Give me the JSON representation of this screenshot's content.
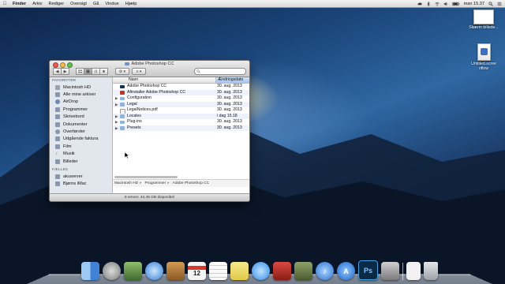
{
  "menubar": {
    "apple_glyph": "",
    "app_name": "Finder",
    "menus": [
      "Arkiv",
      "Rediger",
      "Oversigt",
      "Gå",
      "Vindue",
      "Hjælp"
    ],
    "clock": "man 15.37",
    "status_icons": [
      "cloud-icon",
      "bluetooth-icon",
      "wifi-icon",
      "volume-icon",
      "battery-icon",
      "search-icon",
      "list-icon"
    ]
  },
  "desktop_items": [
    {
      "label": "Skærm billede...",
      "icon": "screenshot-icon"
    },
    {
      "label": "Untitled.scree nflow",
      "icon": "screenflow-document-icon"
    }
  ],
  "window": {
    "title": "Adobe Photoshop CC",
    "search_placeholder": "",
    "toolbar": {
      "back": "◀",
      "forward": "▶",
      "action": "⚙ ▾",
      "arrange": "≡ ▾"
    },
    "sidebar": {
      "favorites_header": "FAVORITTER",
      "favorites": [
        {
          "label": "Macintosh HD",
          "icon": "hard-drive-icon"
        },
        {
          "label": "Alle mine arkiver",
          "icon": "all-files-icon"
        },
        {
          "label": "AirDrop",
          "icon": "airdrop-icon"
        },
        {
          "label": "Programmer",
          "icon": "applications-icon"
        },
        {
          "label": "Skrivebord",
          "icon": "desktop-icon"
        },
        {
          "label": "Dokumenter",
          "icon": "documents-icon"
        },
        {
          "label": "Overførsler",
          "icon": "downloads-icon"
        },
        {
          "label": "Udgående faktura",
          "icon": "folder-icon"
        },
        {
          "label": "Film",
          "icon": "movies-icon"
        },
        {
          "label": "Musik",
          "icon": "music-icon"
        },
        {
          "label": "Billeder",
          "icon": "pictures-icon"
        }
      ],
      "shared_header": "FÆLLES",
      "shared": [
        {
          "label": "akuserver",
          "icon": "server-icon"
        },
        {
          "label": "Bjørns iMac",
          "icon": "imac-icon"
        }
      ]
    },
    "columns": {
      "name": "Navn",
      "date": "Ændringsdato"
    },
    "files": [
      {
        "name": "Adobe Photoshop CC",
        "date": "30. aug. 2013",
        "expandable": false,
        "icon": "photoshop-app-icon"
      },
      {
        "name": "Afinstaller Adobe Photoshop CC",
        "date": "30. aug. 2013",
        "expandable": false,
        "icon": "uninstaller-icon"
      },
      {
        "name": "Configuration",
        "date": "30. aug. 2013",
        "expandable": true,
        "icon": "folder-icon"
      },
      {
        "name": "Legal",
        "date": "30. aug. 2013",
        "expandable": true,
        "icon": "folder-icon"
      },
      {
        "name": "LegalNotices.pdf",
        "date": "30. aug. 2013",
        "expandable": false,
        "icon": "pdf-icon"
      },
      {
        "name": "Locales",
        "date": "i dag 15.18",
        "expandable": true,
        "icon": "folder-icon"
      },
      {
        "name": "Plug-ins",
        "date": "30. aug. 2013",
        "expandable": true,
        "icon": "folder-icon"
      },
      {
        "name": "Presets",
        "date": "30. aug. 2013",
        "expandable": true,
        "icon": "folder-icon"
      }
    ],
    "path": [
      "Macintosh HD",
      "Programmer",
      "Adobe Photoshop CC"
    ],
    "status": "8 emner, 44,45 GB disponibel"
  },
  "dock": {
    "items": [
      {
        "name": "finder",
        "icon": "finder-icon",
        "color": "#4a8fe0"
      },
      {
        "name": "launchpad",
        "icon": "launchpad-icon",
        "color": "#8c8c8c"
      },
      {
        "name": "preview",
        "icon": "preview-icon",
        "color": "#5c8a4a"
      },
      {
        "name": "safari",
        "icon": "safari-icon",
        "color": "#3d8ed8"
      },
      {
        "name": "books",
        "icon": "contacts-icon",
        "color": "#b07a3a"
      },
      {
        "name": "calendar",
        "icon": "calendar-icon",
        "color": "#e8e8e8"
      },
      {
        "name": "reminders",
        "icon": "reminders-icon",
        "color": "#f4f4f4"
      },
      {
        "name": "notes",
        "icon": "notes-icon",
        "color": "#f2e27a"
      },
      {
        "name": "messages",
        "icon": "messages-icon",
        "color": "#4aa7f0"
      },
      {
        "name": "photo-booth",
        "icon": "photo-booth-icon",
        "color": "#b8332e"
      },
      {
        "name": "iphoto",
        "icon": "iphoto-icon",
        "color": "#6b7a4a"
      },
      {
        "name": "itunes",
        "icon": "itunes-icon",
        "color": "#3a7fd6"
      },
      {
        "name": "app-store",
        "icon": "app-store-icon",
        "color": "#2f7fe0"
      },
      {
        "name": "photoshop",
        "icon": "photoshop-icon",
        "color": "#0b2a45"
      },
      {
        "name": "screenflow",
        "icon": "screenflow-icon",
        "color": "#9a9a9a"
      },
      {
        "name": "document",
        "icon": "document-stack-icon",
        "color": "#efefef"
      },
      {
        "name": "trash",
        "icon": "trash-icon",
        "color": "#b8bcc2"
      }
    ],
    "calendar_day": "12",
    "photoshop_label": "Ps"
  }
}
